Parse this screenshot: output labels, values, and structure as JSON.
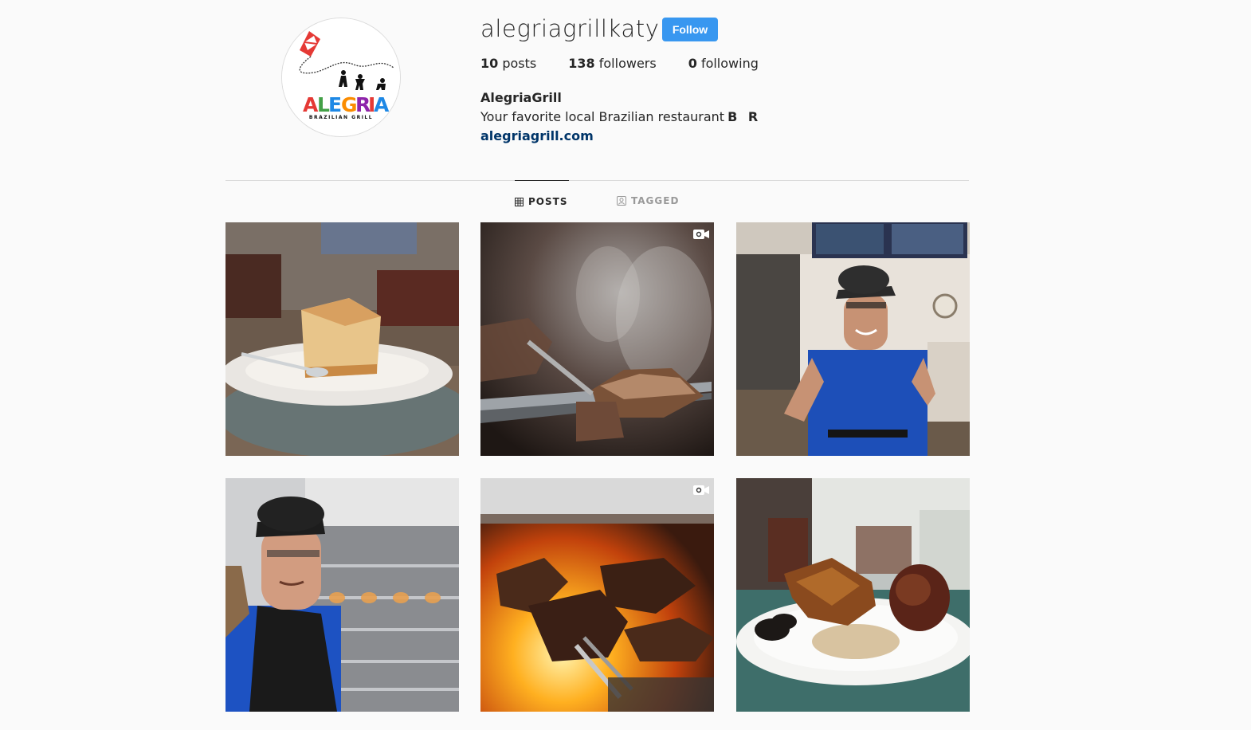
{
  "profile": {
    "username": "alegriagrillkaty",
    "follow_label": "Follow",
    "stats": {
      "posts_count": "10",
      "posts_label": "posts",
      "followers_count": "138",
      "followers_label": "followers",
      "following_count": "0",
      "following_label": "following"
    },
    "display_name": "AlegriaGrill",
    "bio": "Your favorite local Brazilian restaurant",
    "bio_flag": "B R",
    "website": "alegriagrill.com",
    "avatar_logo_text": "ALEGRIA",
    "avatar_logo_sub": "BRAZILIAN GRILL"
  },
  "tabs": [
    {
      "label": "POSTS",
      "icon": "grid-icon",
      "active": true
    },
    {
      "label": "TAGGED",
      "icon": "tagged-icon",
      "active": false
    }
  ],
  "posts": [
    {
      "subject": "flan dessert on plate",
      "video": false
    },
    {
      "subject": "grilled meat skewer with steam",
      "video": true
    },
    {
      "subject": "smiling staff in blue shirt",
      "video": false
    },
    {
      "subject": "chef with cap by rotisserie",
      "video": false
    },
    {
      "subject": "meat on skewers over flames",
      "video": true
    },
    {
      "subject": "chicken, beans and farofa plate",
      "video": false
    }
  ],
  "colors": {
    "follow_button": "#3897f0",
    "link": "#003569",
    "background": "#fafafa"
  }
}
